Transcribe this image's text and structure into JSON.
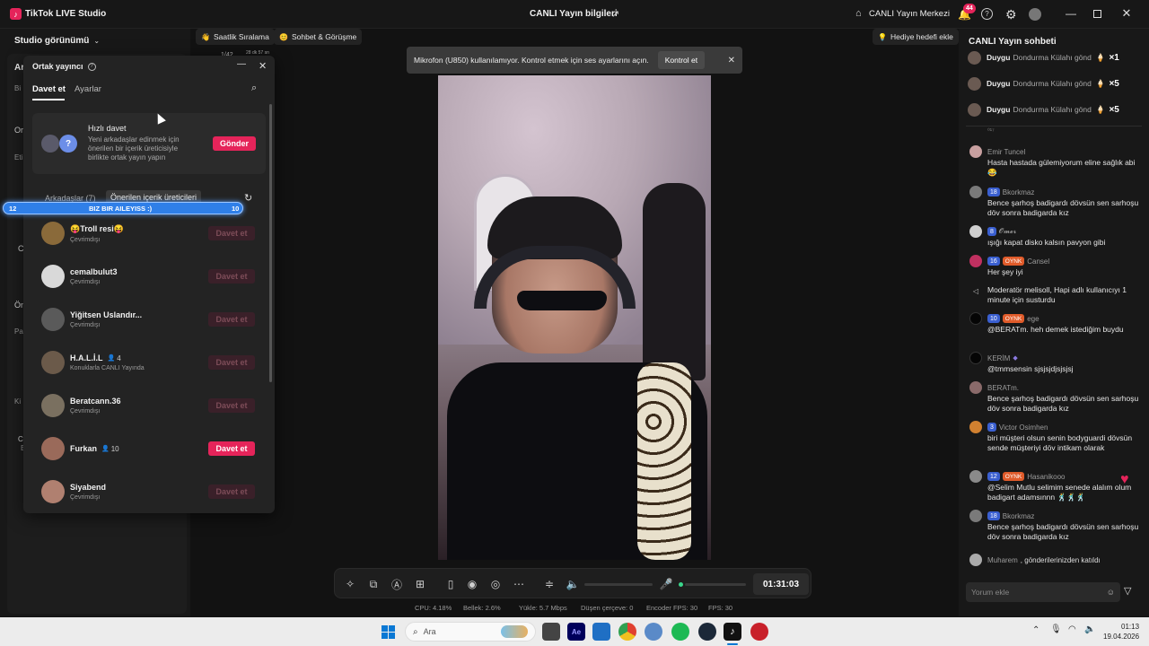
{
  "titlebar": {
    "app_name": "TikTok LIVE Studio",
    "center_title": "CANLI Yayın bilgileri",
    "live_center": "CANLI Yayın Merkezi",
    "notif_count": "44"
  },
  "sidebar": {
    "studio_view": "Studio görünümü",
    "partial_labels": [
      "Ar",
      "Bi",
      "Or",
      "Eti",
      "Ci",
      "Ön",
      "Pa",
      "Ki",
      "C",
      "E"
    ]
  },
  "popup": {
    "title": "Ortak yayıncı",
    "tabs": [
      "Davet et",
      "Ayarlar"
    ],
    "quick_invite": {
      "title": "Hızlı davet",
      "desc": "Yeni arkadaşlar edinmek için önerilen bir içerik üreticisiyle birlikte ortak yayın yapın",
      "button": "Gönder"
    },
    "filter_tabs": [
      "Arkadaşlar (7)",
      "Önerilen içerik üreticileri"
    ],
    "users": [
      {
        "name": "😝Troll resi😝",
        "status": "Çevrimdışı",
        "button": "Davet et",
        "active": false,
        "color": "#8a6a3a"
      },
      {
        "name": "cemalbulut3",
        "status": "Çevrimdışı",
        "button": "Davet et",
        "active": false,
        "color": "#d9d9d9"
      },
      {
        "name": "Yiğitsen Uslandır...",
        "status": "Çevrimdışı",
        "button": "Davet et",
        "active": false,
        "color": "#5a5a5a"
      },
      {
        "name": "H.A.L.İ.L",
        "status": "Konuklarla CANLI Yayında",
        "button": "Davet et",
        "active": false,
        "count": "4",
        "color": "#6b5a4a"
      },
      {
        "name": "Beratcann.36",
        "status": "Çevrimdışı",
        "button": "Davet et",
        "active": false,
        "color": "#7a7060"
      },
      {
        "name": "Furkan",
        "status": "",
        "button": "Davet et",
        "active": true,
        "count": "10",
        "color": "#9a6a5a"
      },
      {
        "name": "Siyabend",
        "status": "Çevrimdışı",
        "button": "Davet et",
        "active": false,
        "color": "#b08070"
      }
    ]
  },
  "progress_bar": {
    "left": "12",
    "label": "BIZ BIR AILEYISS :)",
    "right": "10"
  },
  "top_pills": {
    "ranking": "Saatlik Sıralama",
    "chat": "Sohbet & Görüşme",
    "goal": "Hediye hedefi ekle",
    "partial_counter": "1/42",
    "partial_time": "28 dk 57 sn"
  },
  "notification": {
    "text": "Mikrofon (U850) kullanılamıyor. Kontrol etmek için ses ayarlarını açın.",
    "button": "Kontrol et"
  },
  "controls": {
    "timer": "01:31:03"
  },
  "stats": {
    "cpu": "CPU: 4.18%",
    "mem": "Bellek: 2.6%",
    "upload": "Yükle: 5.7 Mbps",
    "dropped": "Düşen çerçeve: 0",
    "enc_fps": "Encoder FPS: 30",
    "fps": "FPS: 30"
  },
  "chat": {
    "title": "CANLI Yayın sohbeti",
    "gifts": [
      {
        "user": "Duygu",
        "item": "Dondurma Külahı gönd",
        "count": "×1"
      },
      {
        "user": "Duygu",
        "item": "Dondurma Külahı gönd",
        "count": "×5"
      },
      {
        "user": "Duygu",
        "item": "Dondurma Külahı gönd",
        "count": "×5"
      }
    ],
    "partial_top": "⁰¹⁷",
    "messages": [
      {
        "user": "Emir Tuncel",
        "level": "",
        "badge": "",
        "text": "Hasta hastada gülemiyorum eline sağlık abi 😂",
        "color": "#c8a0a0"
      },
      {
        "user": "Bkorkmaz",
        "level": "18",
        "badge": "",
        "text": "Bence şarhoş badigardı dövsün sen sarhoşu döv sonra badigarda kız",
        "color": "#7a7a7a"
      },
      {
        "user": "𝓞𝓶𝓮𝓻",
        "level": "8",
        "badge": "",
        "text": "ışığı kapat disko kalsın pavyon gibi",
        "color": "#cfcfcf"
      },
      {
        "user": "Cansel",
        "level": "16",
        "badge": "OYNK",
        "text": "Her şey iyi",
        "color": "#c03060"
      },
      {
        "user": "Moderatör",
        "level": "",
        "badge": "",
        "text": "Moderatör melisoll, Hapi adlı kullanıcıyı 1 minute için susturdu",
        "color": "#181818"
      },
      {
        "user": "ege",
        "level": "10",
        "badge": "OYNK",
        "text": "@BERATm. heh demek istediğim buydu",
        "color": "#050505"
      },
      {
        "user": "KERİM",
        "level": "",
        "badge": "",
        "text": "@tmmsensin sjsjsjdjsjsjsj",
        "color": "#050505"
      },
      {
        "user": "BERATm.",
        "level": "",
        "badge": "",
        "text": "Bence şarhoş badigardı dövsün sen sarhoşu döv sonra badigarda kız",
        "color": "#8a6a6a"
      },
      {
        "user": "Victor Osimhen",
        "level": "3",
        "badge": "",
        "text": "biri müşteri olsun senin bodyguardi dövsün sende müşteriyi döv intikam olarak",
        "color": "#d08030"
      },
      {
        "user": "Hasanikooo",
        "level": "12",
        "badge": "OYNK",
        "text": "@Selim Mutlu selimim senede alalım olum badigart adamsınnn 🕺🕺🕺",
        "color": "#8a8a8a"
      },
      {
        "user": "Bkorkmaz",
        "level": "18",
        "badge": "",
        "text": "Bence şarhoş badigardı dövsün sen sarhoşu döv sonra badigarda kız",
        "color": "#7a7a7a"
      }
    ],
    "joined": {
      "user": "Muharem",
      "text": ", gönderilerinizden katıldı"
    },
    "input_placeholder": "Yorum ekle"
  },
  "taskbar": {
    "search": "Ara",
    "time": "01:13",
    "date": "19.04.2026"
  }
}
